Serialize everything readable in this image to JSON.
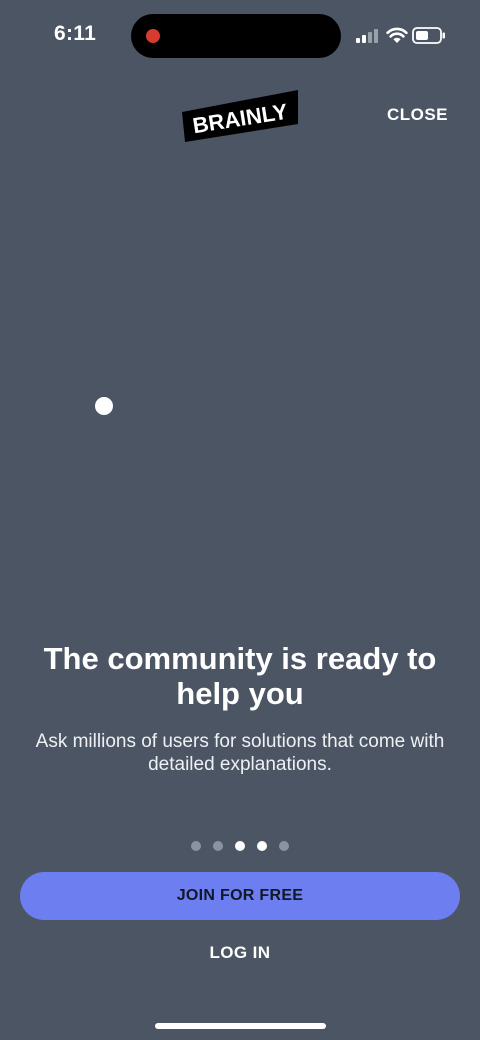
{
  "status_bar": {
    "time": "6:11"
  },
  "header": {
    "logo_text": "BRAINLY",
    "close_label": "CLOSE"
  },
  "onboarding": {
    "headline": "The community is ready to help you",
    "subtext": "Ask millions of users for solutions that come with detailed explanations.",
    "page_count": 5,
    "active_pages": [
      3,
      4
    ]
  },
  "actions": {
    "join_label": "JOIN FOR FREE",
    "login_label": "LOG IN"
  },
  "colors": {
    "background": "#4c5563",
    "primary_button": "#6d7ef0",
    "text": "#ffffff",
    "recording_dot": "#d63b2f"
  },
  "icons": [
    "recording-indicator-icon",
    "signal-icon",
    "wifi-icon",
    "battery-icon",
    "brainly-logo"
  ]
}
